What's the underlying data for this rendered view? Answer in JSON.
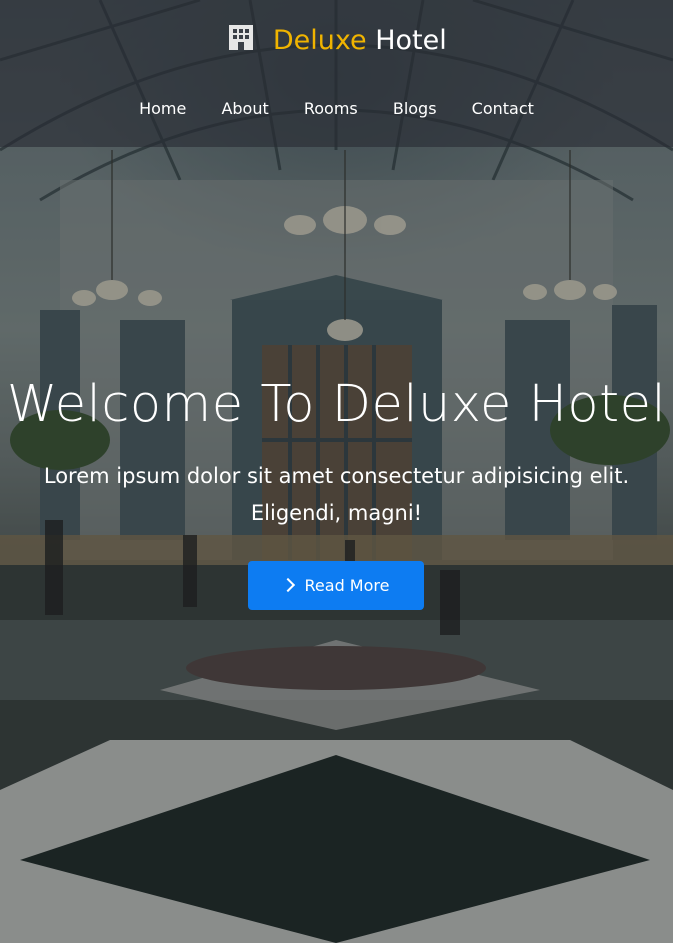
{
  "brand": {
    "name_accent": "Deluxe",
    "name_rest": "Hotel",
    "icon": "hotel-building-icon",
    "accent_color": "#f0b400"
  },
  "nav": {
    "items": [
      {
        "label": "Home"
      },
      {
        "label": "About"
      },
      {
        "label": "Rooms"
      },
      {
        "label": "Blogs"
      },
      {
        "label": "Contact"
      }
    ]
  },
  "hero": {
    "title": "Welcome To Deluxe Hotel",
    "subtitle": "Lorem ipsum dolor sit amet consectetur adipisicing elit. Eligendi, magni!",
    "cta_label": "Read More",
    "cta_icon": "chevron-right-icon",
    "cta_color": "#0d7cf2"
  }
}
